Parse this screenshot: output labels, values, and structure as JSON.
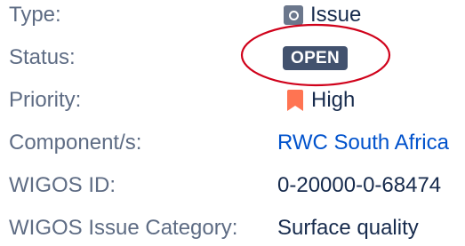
{
  "fields": {
    "type": {
      "label": "Type:",
      "value": "Issue",
      "icon": "issue-type-icon"
    },
    "status": {
      "label": "Status:",
      "value": "OPEN",
      "color": "#42526e"
    },
    "priority": {
      "label": "Priority:",
      "value": "High",
      "icon": "priority-high-icon",
      "color": "#ff7452"
    },
    "components": {
      "label": "Component/s:",
      "value": "RWC South Africa"
    },
    "wigos_id": {
      "label": "WIGOS ID:",
      "value": "0-20000-0-68474"
    },
    "wigos_issue_category": {
      "label": "WIGOS Issue Category:",
      "value": "Surface quality"
    }
  },
  "annotation": {
    "shape": "ellipse",
    "color": "#d0021b"
  },
  "colors": {
    "label_text": "#5e6c84",
    "value_text": "#172b4d",
    "link_text": "#0052cc"
  }
}
